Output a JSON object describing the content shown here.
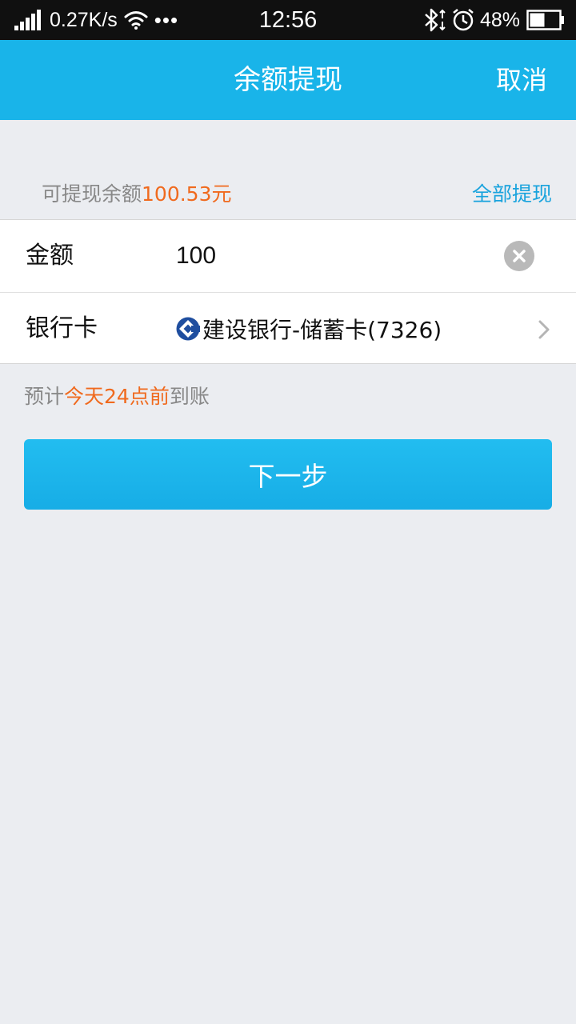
{
  "status_bar": {
    "network_speed": "0.27K/s",
    "more_dots": "•••",
    "time": "12:56",
    "battery_percent": "48%",
    "icons": [
      "signal-icon",
      "wifi-icon",
      "bluetooth-icon",
      "alarm-icon",
      "battery-icon"
    ]
  },
  "nav": {
    "title": "余额提现",
    "cancel_label": "取消"
  },
  "balance": {
    "label": "可提现余额",
    "amount": "100.53元",
    "withdraw_all_label": "全部提现"
  },
  "form": {
    "amount_label": "金额",
    "amount_value": "100",
    "card_label": "银行卡",
    "card_value": "建设银行-储蓄卡(7326)"
  },
  "arrival": {
    "prefix": "预计",
    "highlight": "今天24点前",
    "suffix": "到账"
  },
  "next_button_label": "下一步",
  "colors": {
    "accent": "#19b4e9",
    "highlight": "#f06a1e",
    "link": "#19a3dd",
    "background": "#ebedf1"
  }
}
